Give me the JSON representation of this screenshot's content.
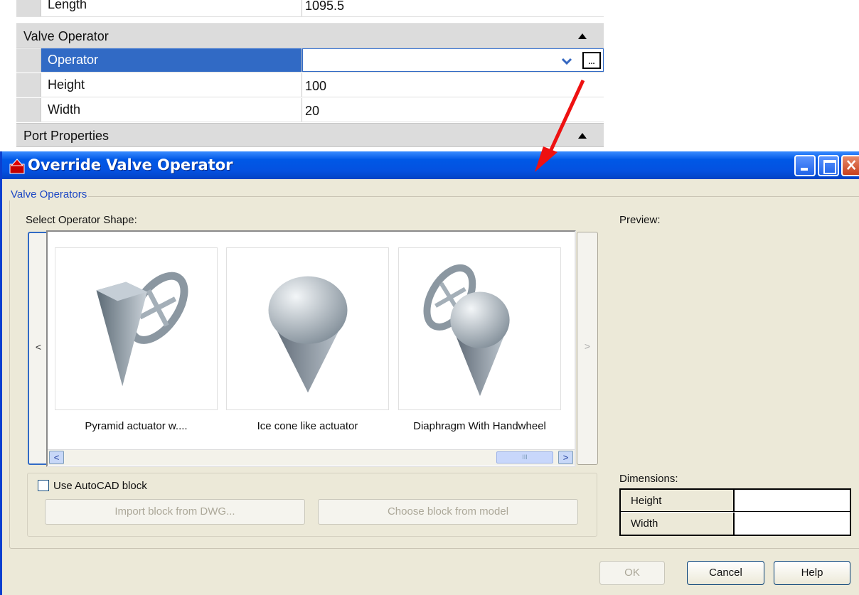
{
  "property_grid": {
    "partial_row": {
      "name": "Length",
      "value": "1095.5"
    },
    "category_valve_operator": "Valve Operator",
    "rows": [
      {
        "name": "Operator",
        "value": ""
      },
      {
        "name": "Height",
        "value": "100"
      },
      {
        "name": "Width",
        "value": "20"
      }
    ],
    "category_port_properties": "Port Properties",
    "ellipsis_glyph": "..."
  },
  "dialog": {
    "title": "Override Valve Operator",
    "group_label": "Valve Operators",
    "select_label": "Select Operator Shape:",
    "preview_label": "Preview:",
    "nav_prev": "<",
    "nav_next": ">",
    "shapes": [
      {
        "caption": "Pyramid actuator w...."
      },
      {
        "caption": "Ice cone like actuator"
      },
      {
        "caption": "Diaphragm With Handwheel"
      }
    ],
    "scroll_left": "<",
    "scroll_right": ">",
    "scroll_grip": "III",
    "use_block_label": "Use AutoCAD block",
    "use_block_checked": false,
    "import_button": "Import block from DWG...",
    "choose_button": "Choose block from model",
    "dimensions_label": "Dimensions:",
    "dimensions": [
      {
        "name": "Height",
        "value": ""
      },
      {
        "name": "Width",
        "value": ""
      }
    ],
    "ok_button": "OK",
    "cancel_button": "Cancel",
    "help_button": "Help"
  },
  "colors": {
    "selection": "#316ac5",
    "title_bar": "#0451e0",
    "dialog_bg": "#ece9d8",
    "annotation_arrow": "#ee1111",
    "group_label": "#1c47c4"
  }
}
